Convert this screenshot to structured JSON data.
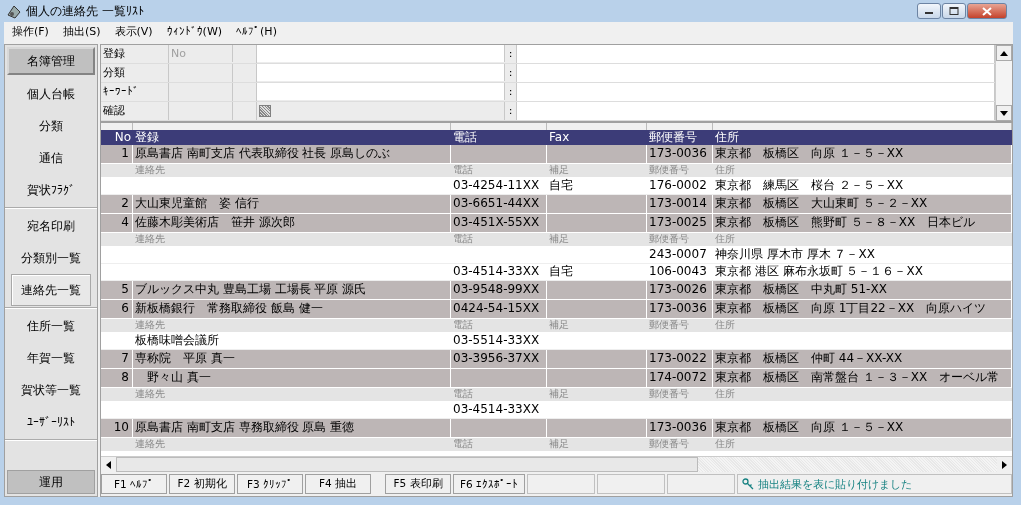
{
  "window": {
    "title": "個人の連絡先 一覧ﾘｽﾄ"
  },
  "menu": [
    "操作(F)",
    "抽出(S)",
    "表示(V)",
    "ｳｨﾝﾄﾞｳ(W)",
    "ﾍﾙﾌﾟ(H)"
  ],
  "sidebar": {
    "header": "名簿管理",
    "groups": [
      [
        {
          "label": "個人台帳",
          "selected": false
        },
        {
          "label": "分類",
          "selected": false
        },
        {
          "label": "通信",
          "selected": false
        },
        {
          "label": "賀状ﾌﾗｸﾞ",
          "selected": false
        }
      ],
      [
        {
          "label": "宛名印刷",
          "selected": false
        },
        {
          "label": "分類別一覧",
          "selected": false
        },
        {
          "label": "連絡先一覧",
          "selected": true
        }
      ],
      [
        {
          "label": "住所一覧",
          "selected": false
        },
        {
          "label": "年賀一覧",
          "selected": false
        },
        {
          "label": "賀状等一覧",
          "selected": false
        },
        {
          "label": "ﾕｰｻﾞｰﾘｽﾄ",
          "selected": false
        }
      ]
    ],
    "footer": "運用"
  },
  "filters": [
    {
      "label": "登録",
      "kind": "text",
      "placeholder": "No",
      "separator": ":"
    },
    {
      "label": "分類",
      "kind": "text",
      "separator": ":"
    },
    {
      "label": "ｷｰﾜｰﾄﾞ",
      "kind": "text",
      "separator": ":"
    },
    {
      "label": "確認",
      "kind": "toggle",
      "separator": ":"
    }
  ],
  "table": {
    "columns": [
      "No",
      "登録",
      "電話",
      "Fax",
      "郵便番号",
      "住所"
    ],
    "rows": [
      {
        "no": "1",
        "name": "原島書店 南町支店 代表取締役 社長 原島しのぶ",
        "postal": "173-0036",
        "address": "東京都　板橋区　向原 １－５－XX",
        "sub_header": [
          "連絡先",
          "電話",
          "補足",
          "郵便番号",
          "住所"
        ],
        "contacts": [
          {
            "phone": "03-4254-11XX",
            "note": "自宅",
            "postal": "176-0002",
            "address": "東京都　練馬区　桜台 ２－５－XX"
          }
        ]
      },
      {
        "no": "2",
        "name": "大山東児童館　姿 信行",
        "phone": "03-6651-44XX",
        "postal": "173-0014",
        "address": "東京都　板橋区　大山東町 ５－２－XX"
      },
      {
        "no": "4",
        "name": "佐藤木彫美術店　笹井 源次郎",
        "phone": "03-451X-55XX",
        "postal": "173-0025",
        "address": "東京都　板橋区　熊野町 ５－８－XX　日本ビル",
        "sub_header": [
          "連絡先",
          "電話",
          "補足",
          "郵便番号",
          "住所"
        ],
        "contacts": [
          {
            "postal": "243-0007",
            "address": "神奈川県 厚木市 厚木 ７－XX"
          },
          {
            "phone": "03-4514-33XX",
            "note": "自宅",
            "postal": "106-0043",
            "address": "東京都 港区 麻布永坂町 ５－１６－XX"
          }
        ]
      },
      {
        "no": "5",
        "name": "ブルックス中丸 豊島工場 工場長 平原 源氏",
        "phone": "03-9548-99XX",
        "postal": "173-0026",
        "address": "東京都　板橋区　中丸町 51-XX"
      },
      {
        "no": "6",
        "name": "新板橋銀行　常務取締役 飯島 健一",
        "phone": "0424-54-15XX",
        "postal": "173-0036",
        "address": "東京都　板橋区　向原 1丁目22－XX　向原ハイツ",
        "sub_header": [
          "連絡先",
          "電話",
          "補足",
          "郵便番号",
          "住所"
        ],
        "contacts": [
          {
            "name": "板橋味噌会議所",
            "phone": "03-5514-33XX"
          }
        ]
      },
      {
        "no": "7",
        "name": "専称院　平原 真一",
        "phone": "03-3956-37XX",
        "postal": "173-0022",
        "address": "東京都　板橋区　仲町 44－XX-XX"
      },
      {
        "no": "8",
        "name": "　野々山 真一",
        "postal": "174-0072",
        "address": "東京都　板橋区　南常盤台 １－３－XX　オーベル常",
        "sub_header": [
          "連絡先",
          "電話",
          "補足",
          "郵便番号",
          "住所"
        ],
        "contacts": [
          {
            "phone": "03-4514-33XX"
          }
        ]
      },
      {
        "no": "10",
        "name": "原島書店 南町支店 専務取締役 原島 重徳",
        "postal": "173-0036",
        "address": "東京都　板橋区　向原 １－５－XX",
        "sub_header": [
          "連絡先",
          "電話",
          "補足",
          "郵便番号",
          "住所"
        ]
      }
    ]
  },
  "function_keys": [
    "F1 ﾍﾙﾌﾟ",
    "F2 初期化",
    "F3 ｸﾘｯﾌﾟ",
    "F4 抽出",
    "F5 表印刷",
    "F6 ｴｸｽﾎﾟｰﾄ"
  ],
  "status_bar": {
    "message": "抽出結果を表に貼り付けました"
  }
}
